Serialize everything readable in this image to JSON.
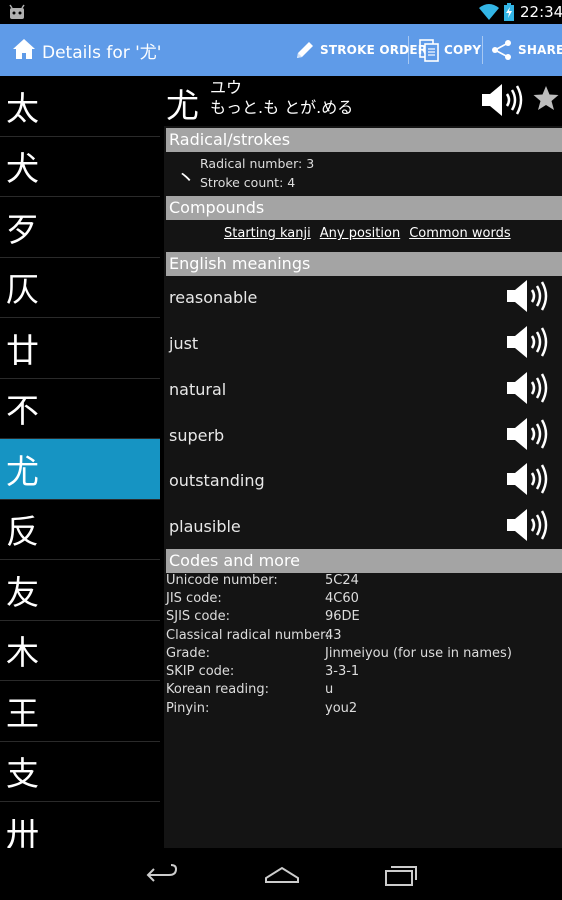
{
  "status_bar": {
    "time": "22:34"
  },
  "action_bar": {
    "title": "Details for '尤'",
    "stroke_order": "STROKE ORDER",
    "copy": "COPY",
    "share": "SHARE"
  },
  "kanji_list": [
    "太",
    "犬",
    "歹",
    "仄",
    "廿",
    "不",
    "尤",
    "反",
    "友",
    "木",
    "王",
    "支",
    "卅"
  ],
  "selected_kanji": "尤",
  "header": {
    "kanji": "尤",
    "on_reading": "ユウ",
    "kun_reading": "もっと.も とが.める"
  },
  "sections": {
    "radical": "Radical/strokes",
    "compounds": "Compounds",
    "meanings": "English meanings",
    "codes": "Codes and more"
  },
  "radical": {
    "char": "丶",
    "number_label": "Radical number:",
    "number": "3",
    "strokes_label": "Stroke count:",
    "strokes": "4"
  },
  "compound_links": [
    "Starting kanji",
    "Any position",
    "Common words"
  ],
  "meanings": [
    "reasonable",
    "just",
    "natural",
    "superb",
    "outstanding",
    "plausible"
  ],
  "codes": [
    {
      "label": "Unicode number:",
      "value": "5C24"
    },
    {
      "label": "JIS code:",
      "value": "4C60"
    },
    {
      "label": "SJIS code:",
      "value": "96DE"
    },
    {
      "label": "Classical radical number:",
      "value": "43"
    },
    {
      "label": "Grade:",
      "value": "Jinmeiyou (for use in names)"
    },
    {
      "label": "SKIP code:",
      "value": "3-3-1"
    },
    {
      "label": "Korean reading:",
      "value": "u"
    },
    {
      "label": "Pinyin:",
      "value": "you2"
    }
  ],
  "colors": {
    "action_bar": "#5f9be8",
    "selected_item": "#1694c3",
    "section_header": "#a4a4a4"
  }
}
